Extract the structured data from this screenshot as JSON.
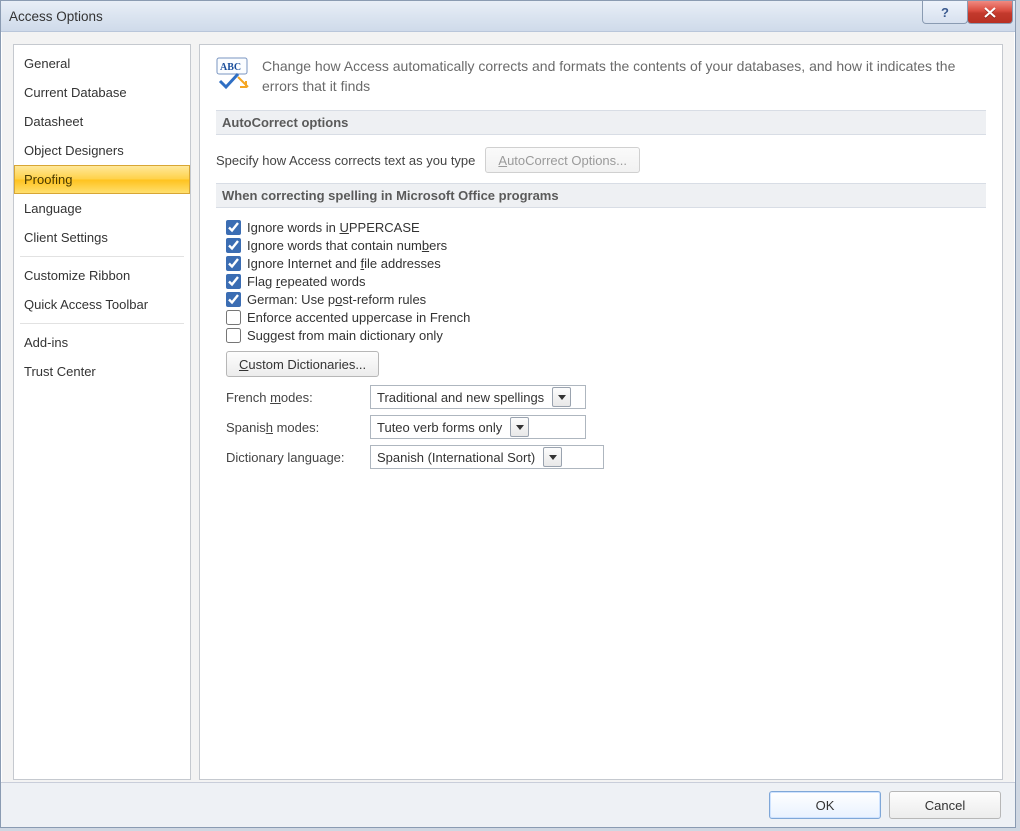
{
  "window": {
    "title": "Access Options"
  },
  "sidebar": {
    "items": [
      {
        "label": "General"
      },
      {
        "label": "Current Database"
      },
      {
        "label": "Datasheet"
      },
      {
        "label": "Object Designers"
      },
      {
        "label": "Proofing",
        "selected": true
      },
      {
        "label": "Language"
      },
      {
        "label": "Client Settings"
      },
      {
        "label": "Customize Ribbon"
      },
      {
        "label": "Quick Access Toolbar"
      },
      {
        "label": "Add-ins"
      },
      {
        "label": "Trust Center"
      }
    ],
    "separators_after": [
      6,
      8
    ]
  },
  "header": {
    "description": "Change how Access automatically corrects and formats the contents of your databases, and how it indicates the errors that it finds"
  },
  "autocorrect": {
    "section_title": "AutoCorrect options",
    "label": "Specify how Access corrects text as you type",
    "button": "AutoCorrect Options...",
    "button_enabled": false
  },
  "spelling": {
    "section_title": "When correcting spelling in Microsoft Office programs",
    "checks": [
      {
        "label": "Ignore words in UPPERCASE",
        "checked": true,
        "ukey": "U"
      },
      {
        "label": "Ignore words that contain numbers",
        "checked": true,
        "ukey": "b"
      },
      {
        "label": "Ignore Internet and file addresses",
        "checked": true,
        "ukey": "f"
      },
      {
        "label": "Flag repeated words",
        "checked": true,
        "ukey": "r"
      },
      {
        "label": "German: Use post-reform rules",
        "checked": true,
        "ukey": "o"
      },
      {
        "label": "Enforce accented uppercase in French",
        "checked": false,
        "ukey": ""
      },
      {
        "label": "Suggest from main dictionary only",
        "checked": false,
        "ukey": ""
      }
    ],
    "custom_dict_button": "Custom Dictionaries...",
    "french_label": "French modes:",
    "french_value": "Traditional and new spellings",
    "spanish_label": "Spanish modes:",
    "spanish_value": "Tuteo verb forms only",
    "dict_lang_label": "Dictionary language:",
    "dict_lang_value": "Spanish (International Sort)"
  },
  "footer": {
    "ok": "OK",
    "cancel": "Cancel"
  }
}
